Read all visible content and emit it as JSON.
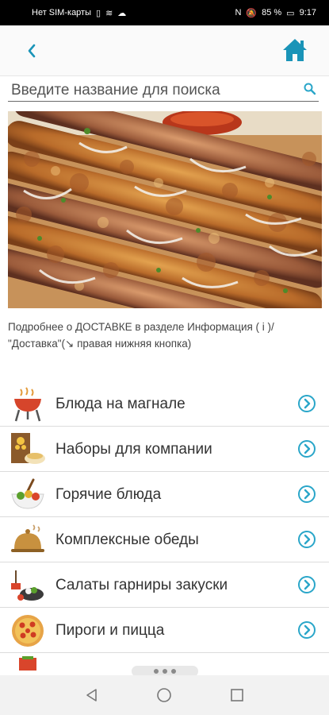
{
  "status_bar": {
    "carrier": "Нет SIM-карты",
    "battery": "85 %",
    "time": "9:17"
  },
  "search": {
    "placeholder": "Введите название для поиска"
  },
  "info_text": "Подробнее о ДОСТАВКЕ в разделе Информация ( i )/ \"Доставка\"(↘ правая нижняя кнопка)",
  "menu": [
    {
      "label": "Блюда на магнале",
      "icon": "grill-icon"
    },
    {
      "label": "Наборы для компании",
      "icon": "company-set-icon"
    },
    {
      "label": "Горячие блюда",
      "icon": "hot-dish-icon"
    },
    {
      "label": "Комплексные обеды",
      "icon": "cloche-icon"
    },
    {
      "label": "Салаты гарниры закуски",
      "icon": "salad-icon"
    },
    {
      "label": "Пироги и пицца",
      "icon": "pizza-icon"
    }
  ],
  "colors": {
    "accent": "#1a94b8",
    "arrow": "#2aa6c9"
  }
}
